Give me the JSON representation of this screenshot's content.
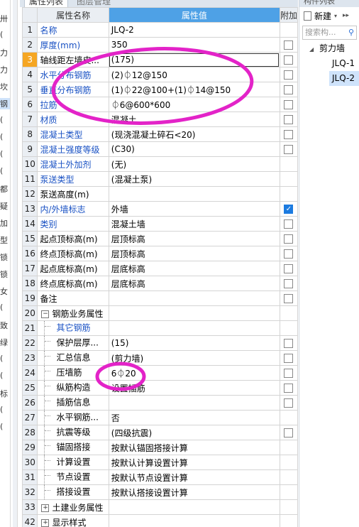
{
  "left_strip": {
    "glyphs": [
      "卅",
      "(",
      "力",
      "力",
      "坎",
      "钢",
      "(",
      "(",
      "(",
      "(",
      "都",
      "疑",
      "加",
      "型",
      "锁",
      "锁",
      "女",
      "(",
      "致",
      "绿",
      "(",
      "(",
      "标",
      "(",
      "("
    ]
  },
  "tabs": {
    "properties": "属性列表",
    "layers": "图层管理"
  },
  "grid": {
    "headers": {
      "name": "属性名称",
      "value": "属性值",
      "extra": "附加"
    },
    "rows": [
      {
        "num": "1",
        "name": "名称",
        "value": "JLQ-2",
        "blue": true,
        "checkbox": null
      },
      {
        "num": "2",
        "name": "厚度(mm)",
        "value": "350",
        "blue": true,
        "checkbox": false
      },
      {
        "num": "3",
        "name": "轴线距左墙皮...",
        "value": "(175)",
        "blue": false,
        "checkbox": false,
        "selected": true
      },
      {
        "num": "4",
        "name": "水平分布钢筋",
        "value": "(2)⏀12@150",
        "blue": true,
        "checkbox": false
      },
      {
        "num": "5",
        "name": "垂直分布钢筋",
        "value": "(1)⏀22@100+(1)⏀14@150",
        "blue": true,
        "checkbox": false
      },
      {
        "num": "6",
        "name": "拉筋",
        "value": "⏀6@600*600",
        "blue": true,
        "checkbox": false
      },
      {
        "num": "7",
        "name": "材质",
        "value": "混凝土",
        "blue": true,
        "checkbox": false
      },
      {
        "num": "8",
        "name": "混凝土类型",
        "value": "(现浇混凝土碎石<20)",
        "blue": true,
        "checkbox": false
      },
      {
        "num": "9",
        "name": "混凝土强度等级",
        "value": "(C30)",
        "blue": true,
        "checkbox": false
      },
      {
        "num": "10",
        "name": "混凝土外加剂",
        "value": "(无)",
        "blue": true,
        "checkbox": null
      },
      {
        "num": "11",
        "name": "泵送类型",
        "value": "(混凝土泵)",
        "blue": true,
        "checkbox": null
      },
      {
        "num": "12",
        "name": "泵送高度(m)",
        "value": "",
        "blue": false,
        "checkbox": null
      },
      {
        "num": "13",
        "name": "内/外墙标志",
        "value": "外墙",
        "blue": true,
        "checkbox": true
      },
      {
        "num": "14",
        "name": "类别",
        "value": "混凝土墙",
        "blue": true,
        "checkbox": false
      },
      {
        "num": "15",
        "name": "起点顶标高(m)",
        "value": "层顶标高",
        "blue": false,
        "checkbox": false
      },
      {
        "num": "16",
        "name": "终点顶标高(m)",
        "value": "层顶标高",
        "blue": false,
        "checkbox": false
      },
      {
        "num": "17",
        "name": "起点底标高(m)",
        "value": "层底标高",
        "blue": false,
        "checkbox": false
      },
      {
        "num": "18",
        "name": "终点底标高(m)",
        "value": "层底标高",
        "blue": false,
        "checkbox": false
      },
      {
        "num": "19",
        "name": "备注",
        "value": "",
        "blue": false,
        "checkbox": false
      },
      {
        "num": "20",
        "name": "钢筋业务属性",
        "value": "",
        "group": "minus",
        "checkbox": null
      },
      {
        "num": "21",
        "name": "其它钢筋",
        "value": "",
        "child": true,
        "blue": true,
        "checkbox": null
      },
      {
        "num": "22",
        "name": "保护层厚...",
        "value": "(15)",
        "child": true,
        "checkbox": false
      },
      {
        "num": "23",
        "name": "汇总信息",
        "value": "(剪力墙)",
        "child": true,
        "checkbox": false
      },
      {
        "num": "24",
        "name": "压墙筋",
        "value": "6⏀20",
        "child": true,
        "checkbox": false
      },
      {
        "num": "25",
        "name": "纵筋构造",
        "value": "设置插筋",
        "child": true,
        "checkbox": false
      },
      {
        "num": "26",
        "name": "插筋信息",
        "value": "",
        "child": true,
        "checkbox": false
      },
      {
        "num": "27",
        "name": "水平钢筋...",
        "value": "否",
        "child": true,
        "checkbox": null
      },
      {
        "num": "28",
        "name": "抗震等级",
        "value": "(四级抗震)",
        "child": true,
        "checkbox": false
      },
      {
        "num": "29",
        "name": "锚固搭接",
        "value": "按默认锚固搭接计算",
        "child": true,
        "checkbox": null
      },
      {
        "num": "30",
        "name": "计算设置",
        "value": "按默认计算设置计算",
        "child": true,
        "checkbox": null
      },
      {
        "num": "31",
        "name": "节点设置",
        "value": "按默认节点设置计算",
        "child": true,
        "checkbox": null
      },
      {
        "num": "32",
        "name": "搭接设置",
        "value": "按默认搭接设置计算",
        "child": true,
        "checkbox": null
      },
      {
        "num": "33",
        "name": "土建业务属性",
        "value": "",
        "group": "plus",
        "checkbox": null
      },
      {
        "num": "42",
        "name": "显示样式",
        "value": "",
        "group": "plus",
        "checkbox": null
      }
    ]
  },
  "component_list": {
    "title": "构件列表",
    "new_button": "新建",
    "search_placeholder": "搜索构...",
    "tree": {
      "root": "剪力墙",
      "children": [
        "JLQ-1",
        "JLQ-2"
      ],
      "selected": "JLQ-2"
    }
  },
  "colors": {
    "header_value_bg": "#4ea1e6",
    "selected_row_num": "#f5a623",
    "annotation": "#e323c8",
    "link_blue": "#1a52c4"
  }
}
